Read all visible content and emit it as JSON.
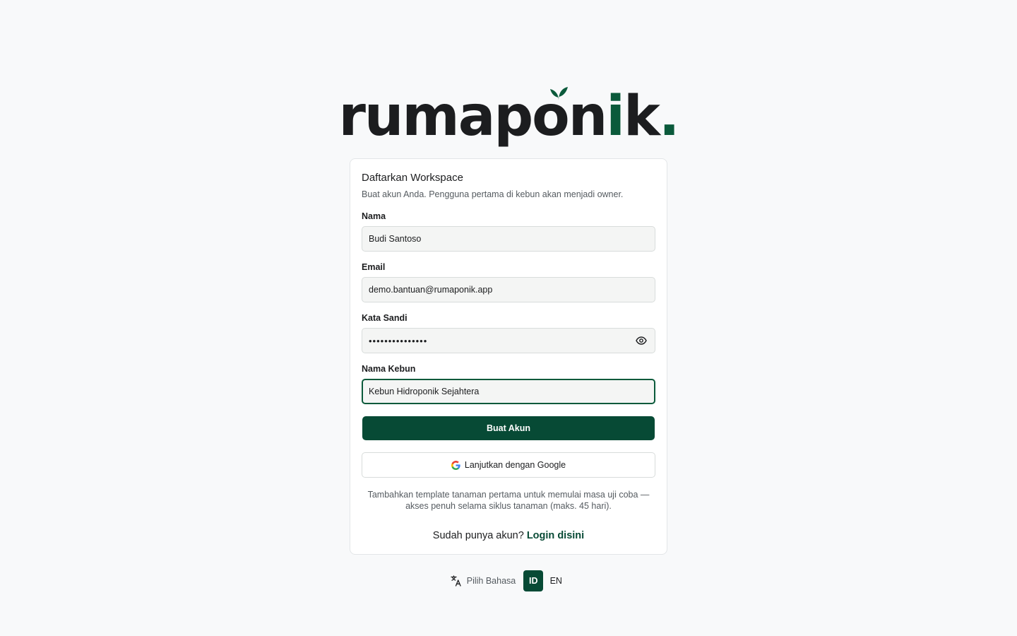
{
  "brand": {
    "wordmark_main": "rumapon",
    "wordmark_i": "i",
    "wordmark_end": "k",
    "wordmark_dot": ".",
    "accent_color": "#0b5a3b"
  },
  "card": {
    "title": "Daftarkan Workspace",
    "subtitle": "Buat akun Anda. Pengguna pertama di kebun akan menjadi owner."
  },
  "form": {
    "name": {
      "label": "Nama",
      "value": "Budi Santoso"
    },
    "email": {
      "label": "Email",
      "value": "demo.bantuan@rumaponik.app"
    },
    "password": {
      "label": "Kata Sandi",
      "value": "•••••••••••••••",
      "toggle_icon": "eye-icon"
    },
    "garden": {
      "label": "Nama Kebun",
      "value": "Kebun Hidroponik Sejahtera"
    },
    "submit_label": "Buat Akun",
    "google_label": "Lanjutkan dengan Google"
  },
  "trial_note": "Tambahkan template tanaman pertama untuk memulai masa uji coba — akses penuh selama siklus tanaman (maks. 45 hari).",
  "login": {
    "prompt": "Sudah punya akun?",
    "link": "Login disini"
  },
  "language": {
    "label": "Pilih Bahasa",
    "options": [
      "ID",
      "EN"
    ],
    "selected": "ID"
  }
}
